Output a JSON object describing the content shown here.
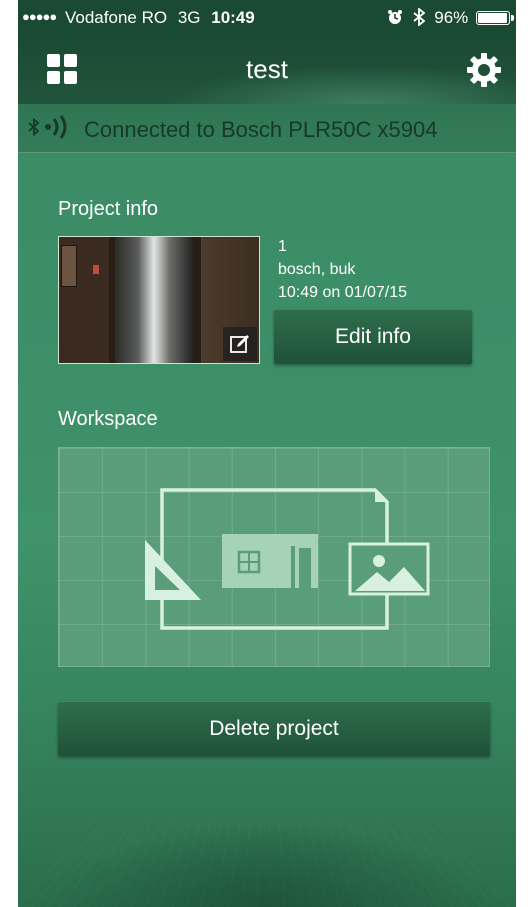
{
  "status_bar": {
    "signal": "●●●●●",
    "carrier": "Vodafone RO",
    "network": "3G",
    "time": "10:49",
    "battery": "96%",
    "icons": [
      "alarm-icon",
      "bluetooth-icon",
      "battery-icon"
    ]
  },
  "nav": {
    "title": "test",
    "left_icon": "grid-icon",
    "right_icon": "gear-icon"
  },
  "connection": {
    "text": "Connected to Bosch PLR50C x5904",
    "icons": [
      "bluetooth-icon",
      "signal-waves-icon"
    ]
  },
  "project_info": {
    "heading": "Project info",
    "number": "1",
    "author": "bosch, buk",
    "date": "10:49 on 01/07/15",
    "edit_button": "Edit info",
    "photo_edit_icon": "pencil-icon"
  },
  "workspace": {
    "heading": "Workspace",
    "icons": [
      "ruler-triangle-icon",
      "floorplan-icon",
      "image-icon",
      "document-icon"
    ]
  },
  "actions": {
    "delete_button": "Delete project"
  },
  "colors": {
    "background_green": "#3d8f68",
    "header_dark": "#1b4a32",
    "button_green": "#27613f",
    "connection_text": "#17392a",
    "workspace_bg": "#5a9e79",
    "icon_line": "#d8f0e0"
  }
}
